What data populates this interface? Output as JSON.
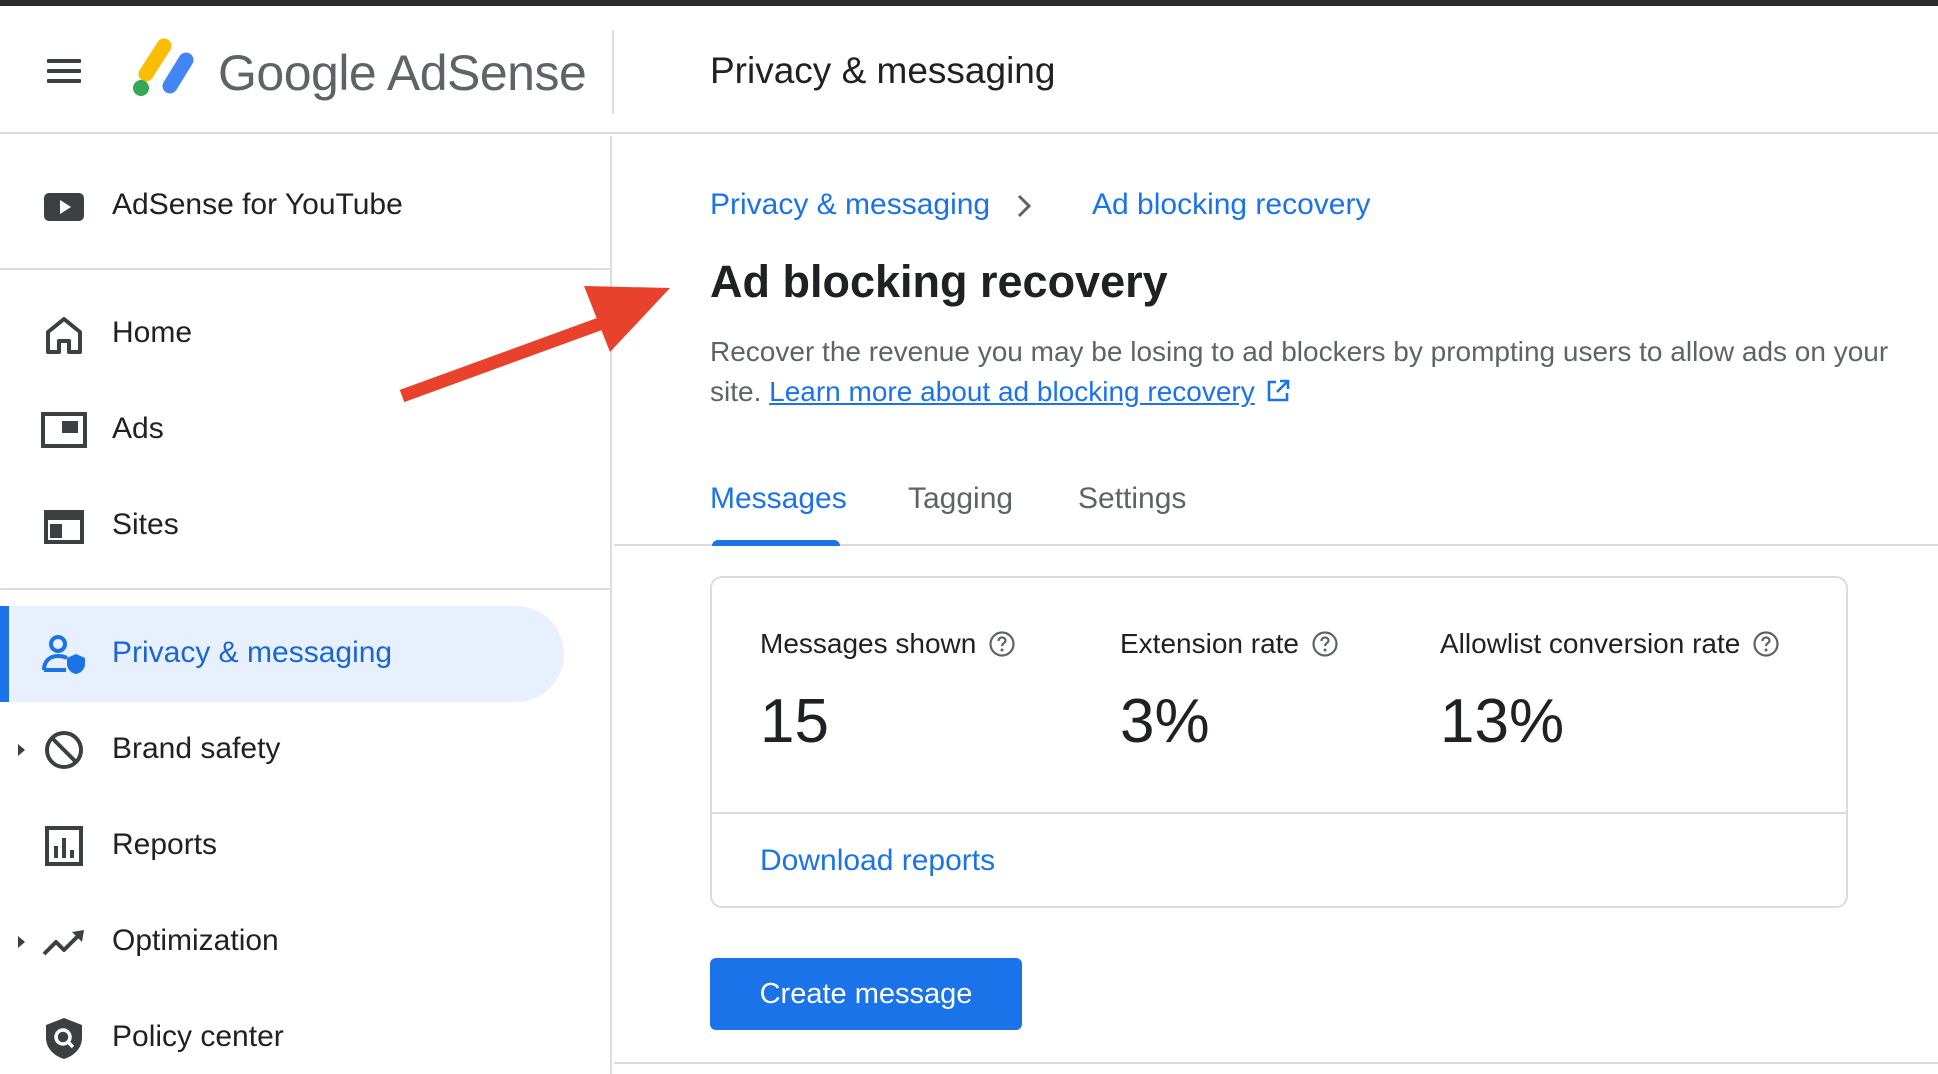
{
  "header": {
    "brand": "Google AdSense",
    "page_title": "Privacy & messaging"
  },
  "sidebar": {
    "items": [
      {
        "label": "AdSense for YouTube",
        "icon": "youtube-icon"
      },
      {
        "label": "Home",
        "icon": "home-icon"
      },
      {
        "label": "Ads",
        "icon": "ads-icon"
      },
      {
        "label": "Sites",
        "icon": "sites-icon"
      },
      {
        "label": "Privacy & messaging",
        "icon": "privacy-user-icon",
        "active": true
      },
      {
        "label": "Brand safety",
        "icon": "block-icon",
        "expandable": true
      },
      {
        "label": "Reports",
        "icon": "bar-chart-icon"
      },
      {
        "label": "Optimization",
        "icon": "trending-up-icon",
        "expandable": true
      },
      {
        "label": "Policy center",
        "icon": "policy-shield-icon"
      }
    ]
  },
  "main": {
    "breadcrumb": {
      "parent": "Privacy & messaging",
      "current": "Ad blocking recovery"
    },
    "title": "Ad blocking recovery",
    "description": "Recover the revenue you may be losing to ad blockers by prompting users to allow ads on your site.",
    "learn_more": "Learn more about ad blocking recovery",
    "tabs": [
      {
        "label": "Messages",
        "active": true
      },
      {
        "label": "Tagging"
      },
      {
        "label": "Settings"
      }
    ],
    "metrics": [
      {
        "label": "Messages shown",
        "value": "15"
      },
      {
        "label": "Extension rate",
        "value": "3%"
      },
      {
        "label": "Allowlist conversion rate",
        "value": "13%"
      }
    ],
    "download_label": "Download reports",
    "create_button": "Create message"
  },
  "colors": {
    "accent": "#1a73e8",
    "active_bg": "#e8f0fe",
    "annotation": "#e8412c"
  }
}
